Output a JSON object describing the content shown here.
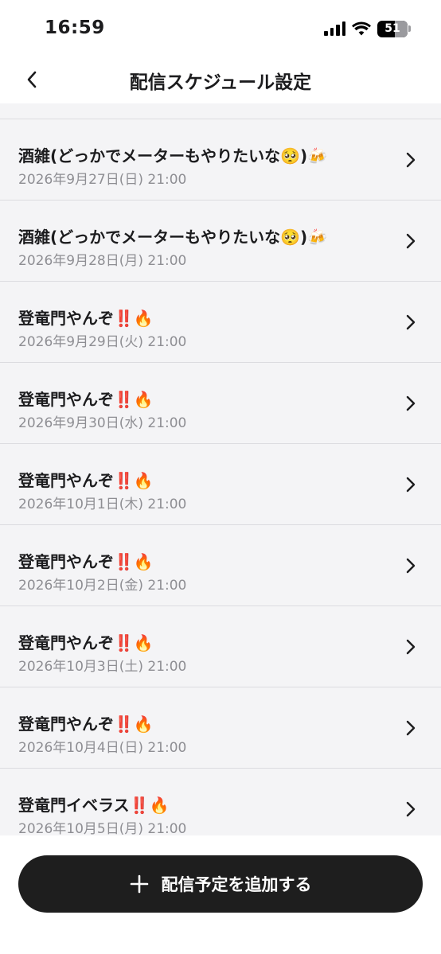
{
  "status_bar": {
    "time": "16:59",
    "battery_level": "51"
  },
  "nav": {
    "title": "配信スケジュール設定"
  },
  "schedule_items": [
    {
      "title": "酒雑(どっかでメーターもやりたいな🥺)🍻",
      "date": "2026年9月27日(日) 21:00"
    },
    {
      "title": "酒雑(どっかでメーターもやりたいな🥺)🍻",
      "date": "2026年9月28日(月) 21:00"
    },
    {
      "title": "登竜門やんぞ‼️🔥",
      "date": "2026年9月29日(火) 21:00"
    },
    {
      "title": "登竜門やんぞ‼️🔥",
      "date": "2026年9月30日(水) 21:00"
    },
    {
      "title": "登竜門やんぞ‼️🔥",
      "date": "2026年10月1日(木) 21:00"
    },
    {
      "title": "登竜門やんぞ‼️🔥",
      "date": "2026年10月2日(金) 21:00"
    },
    {
      "title": "登竜門やんぞ‼️🔥",
      "date": "2026年10月3日(土) 21:00"
    },
    {
      "title": "登竜門やんぞ‼️🔥",
      "date": "2026年10月4日(日) 21:00"
    },
    {
      "title": "登竜門イベラス‼️🔥",
      "date": "2026年10月5日(月) 21:00"
    }
  ],
  "add_button": {
    "icon": "plus-icon",
    "label": "配信予定を追加する"
  },
  "colors": {
    "background": "#f4f4f6",
    "divider": "#dcdce0",
    "date_text": "#8e8e93",
    "button_bg": "#1e1e1e"
  }
}
